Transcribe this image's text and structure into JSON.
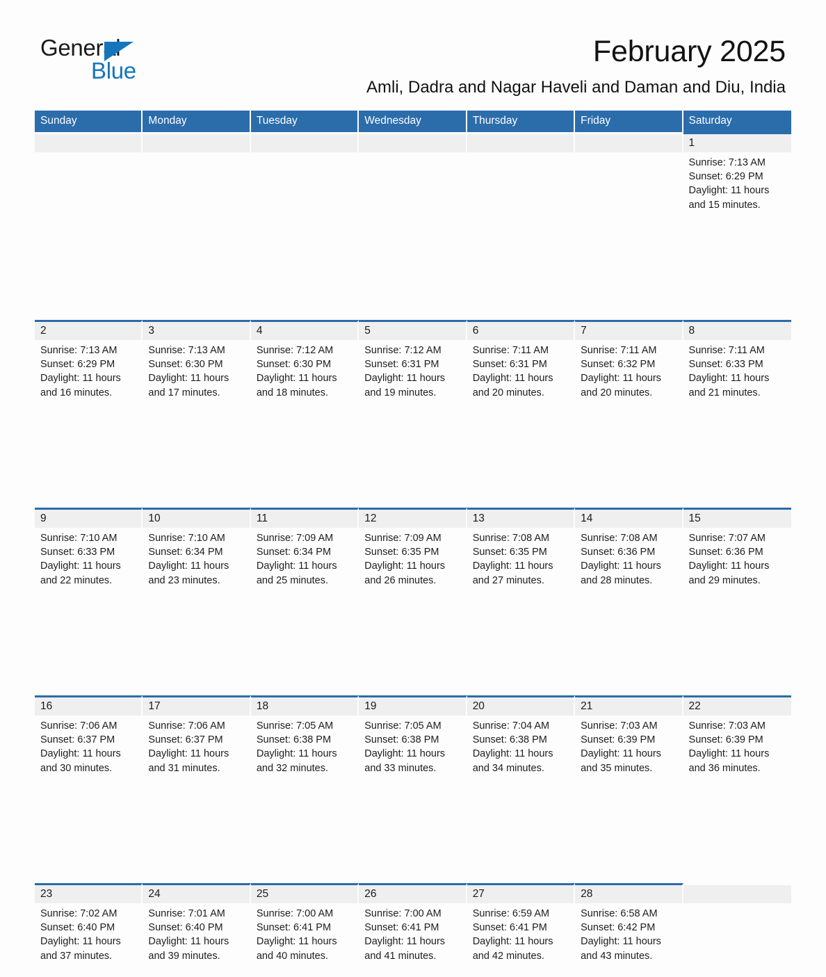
{
  "brand": {
    "name_part1": "General",
    "name_part2": "Blue",
    "accent_color": "#1575bc"
  },
  "header": {
    "title": "February 2025",
    "subtitle": "Amli, Dadra and Nagar Haveli and Daman and Diu, India",
    "header_bg_color": "#2b6cab",
    "day_band_color": "#efefef"
  },
  "weekday_headers": [
    "Sunday",
    "Monday",
    "Tuesday",
    "Wednesday",
    "Thursday",
    "Friday",
    "Saturday"
  ],
  "weeks": [
    [
      {
        "empty": true
      },
      {
        "empty": true
      },
      {
        "empty": true
      },
      {
        "empty": true
      },
      {
        "empty": true
      },
      {
        "empty": true
      },
      {
        "day": "1",
        "sunrise": "Sunrise: 7:13 AM",
        "sunset": "Sunset: 6:29 PM",
        "daylight": "Daylight: 11 hours and 15 minutes."
      }
    ],
    [
      {
        "day": "2",
        "sunrise": "Sunrise: 7:13 AM",
        "sunset": "Sunset: 6:29 PM",
        "daylight": "Daylight: 11 hours and 16 minutes."
      },
      {
        "day": "3",
        "sunrise": "Sunrise: 7:13 AM",
        "sunset": "Sunset: 6:30 PM",
        "daylight": "Daylight: 11 hours and 17 minutes."
      },
      {
        "day": "4",
        "sunrise": "Sunrise: 7:12 AM",
        "sunset": "Sunset: 6:30 PM",
        "daylight": "Daylight: 11 hours and 18 minutes."
      },
      {
        "day": "5",
        "sunrise": "Sunrise: 7:12 AM",
        "sunset": "Sunset: 6:31 PM",
        "daylight": "Daylight: 11 hours and 19 minutes."
      },
      {
        "day": "6",
        "sunrise": "Sunrise: 7:11 AM",
        "sunset": "Sunset: 6:31 PM",
        "daylight": "Daylight: 11 hours and 20 minutes."
      },
      {
        "day": "7",
        "sunrise": "Sunrise: 7:11 AM",
        "sunset": "Sunset: 6:32 PM",
        "daylight": "Daylight: 11 hours and 20 minutes."
      },
      {
        "day": "8",
        "sunrise": "Sunrise: 7:11 AM",
        "sunset": "Sunset: 6:33 PM",
        "daylight": "Daylight: 11 hours and 21 minutes."
      }
    ],
    [
      {
        "day": "9",
        "sunrise": "Sunrise: 7:10 AM",
        "sunset": "Sunset: 6:33 PM",
        "daylight": "Daylight: 11 hours and 22 minutes."
      },
      {
        "day": "10",
        "sunrise": "Sunrise: 7:10 AM",
        "sunset": "Sunset: 6:34 PM",
        "daylight": "Daylight: 11 hours and 23 minutes."
      },
      {
        "day": "11",
        "sunrise": "Sunrise: 7:09 AM",
        "sunset": "Sunset: 6:34 PM",
        "daylight": "Daylight: 11 hours and 25 minutes."
      },
      {
        "day": "12",
        "sunrise": "Sunrise: 7:09 AM",
        "sunset": "Sunset: 6:35 PM",
        "daylight": "Daylight: 11 hours and 26 minutes."
      },
      {
        "day": "13",
        "sunrise": "Sunrise: 7:08 AM",
        "sunset": "Sunset: 6:35 PM",
        "daylight": "Daylight: 11 hours and 27 minutes."
      },
      {
        "day": "14",
        "sunrise": "Sunrise: 7:08 AM",
        "sunset": "Sunset: 6:36 PM",
        "daylight": "Daylight: 11 hours and 28 minutes."
      },
      {
        "day": "15",
        "sunrise": "Sunrise: 7:07 AM",
        "sunset": "Sunset: 6:36 PM",
        "daylight": "Daylight: 11 hours and 29 minutes."
      }
    ],
    [
      {
        "day": "16",
        "sunrise": "Sunrise: 7:06 AM",
        "sunset": "Sunset: 6:37 PM",
        "daylight": "Daylight: 11 hours and 30 minutes."
      },
      {
        "day": "17",
        "sunrise": "Sunrise: 7:06 AM",
        "sunset": "Sunset: 6:37 PM",
        "daylight": "Daylight: 11 hours and 31 minutes."
      },
      {
        "day": "18",
        "sunrise": "Sunrise: 7:05 AM",
        "sunset": "Sunset: 6:38 PM",
        "daylight": "Daylight: 11 hours and 32 minutes."
      },
      {
        "day": "19",
        "sunrise": "Sunrise: 7:05 AM",
        "sunset": "Sunset: 6:38 PM",
        "daylight": "Daylight: 11 hours and 33 minutes."
      },
      {
        "day": "20",
        "sunrise": "Sunrise: 7:04 AM",
        "sunset": "Sunset: 6:38 PM",
        "daylight": "Daylight: 11 hours and 34 minutes."
      },
      {
        "day": "21",
        "sunrise": "Sunrise: 7:03 AM",
        "sunset": "Sunset: 6:39 PM",
        "daylight": "Daylight: 11 hours and 35 minutes."
      },
      {
        "day": "22",
        "sunrise": "Sunrise: 7:03 AM",
        "sunset": "Sunset: 6:39 PM",
        "daylight": "Daylight: 11 hours and 36 minutes."
      }
    ],
    [
      {
        "day": "23",
        "sunrise": "Sunrise: 7:02 AM",
        "sunset": "Sunset: 6:40 PM",
        "daylight": "Daylight: 11 hours and 37 minutes."
      },
      {
        "day": "24",
        "sunrise": "Sunrise: 7:01 AM",
        "sunset": "Sunset: 6:40 PM",
        "daylight": "Daylight: 11 hours and 39 minutes."
      },
      {
        "day": "25",
        "sunrise": "Sunrise: 7:00 AM",
        "sunset": "Sunset: 6:41 PM",
        "daylight": "Daylight: 11 hours and 40 minutes."
      },
      {
        "day": "26",
        "sunrise": "Sunrise: 7:00 AM",
        "sunset": "Sunset: 6:41 PM",
        "daylight": "Daylight: 11 hours and 41 minutes."
      },
      {
        "day": "27",
        "sunrise": "Sunrise: 6:59 AM",
        "sunset": "Sunset: 6:41 PM",
        "daylight": "Daylight: 11 hours and 42 minutes."
      },
      {
        "day": "28",
        "sunrise": "Sunrise: 6:58 AM",
        "sunset": "Sunset: 6:42 PM",
        "daylight": "Daylight: 11 hours and 43 minutes."
      },
      {
        "empty": true
      }
    ]
  ]
}
